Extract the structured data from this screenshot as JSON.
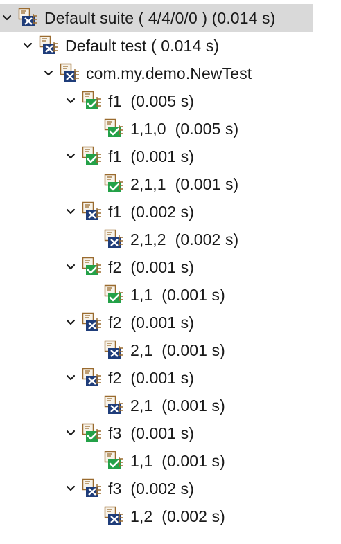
{
  "tree": {
    "suite": {
      "label": "Default suite ( 4/4/0/0 ) (0.014 s)",
      "status": "error",
      "icon": "suite-icon"
    },
    "test": {
      "label": "Default test ( 0.014 s)",
      "status": "error",
      "icon": "test-icon"
    },
    "class": {
      "label": "com.my.demo.NewTest",
      "status": "error",
      "icon": "class-icon"
    },
    "methods": [
      {
        "label": "f1  (0.005 s)",
        "status": "pass",
        "children": [
          {
            "label": "1,1,0  (0.005 s)",
            "status": "pass"
          }
        ]
      },
      {
        "label": "f1  (0.001 s)",
        "status": "pass",
        "children": [
          {
            "label": "2,1,1  (0.001 s)",
            "status": "pass"
          }
        ]
      },
      {
        "label": "f1  (0.002 s)",
        "status": "fail",
        "children": [
          {
            "label": "2,1,2  (0.002 s)",
            "status": "fail"
          }
        ]
      },
      {
        "label": "f2  (0.001 s)",
        "status": "pass",
        "children": [
          {
            "label": "1,1  (0.001 s)",
            "status": "pass"
          }
        ]
      },
      {
        "label": "f2  (0.001 s)",
        "status": "fail",
        "children": [
          {
            "label": "2,1  (0.001 s)",
            "status": "fail"
          }
        ]
      },
      {
        "label": "f2  (0.001 s)",
        "status": "fail",
        "children": [
          {
            "label": "2,1  (0.001 s)",
            "status": "fail"
          }
        ]
      },
      {
        "label": "f3  (0.001 s)",
        "status": "pass",
        "children": [
          {
            "label": "1,1  (0.001 s)",
            "status": "pass"
          }
        ]
      },
      {
        "label": "f3  (0.002 s)",
        "status": "fail",
        "children": [
          {
            "label": "1,2  (0.002 s)",
            "status": "fail"
          }
        ]
      }
    ]
  },
  "colors": {
    "selected_row": "#d9d9d9",
    "text": "#1a1a1a",
    "pass": "#24a148",
    "fail": "#1f3d7a",
    "icon_frame": "#9a6b2f",
    "twisty": "#1a1a1a"
  }
}
